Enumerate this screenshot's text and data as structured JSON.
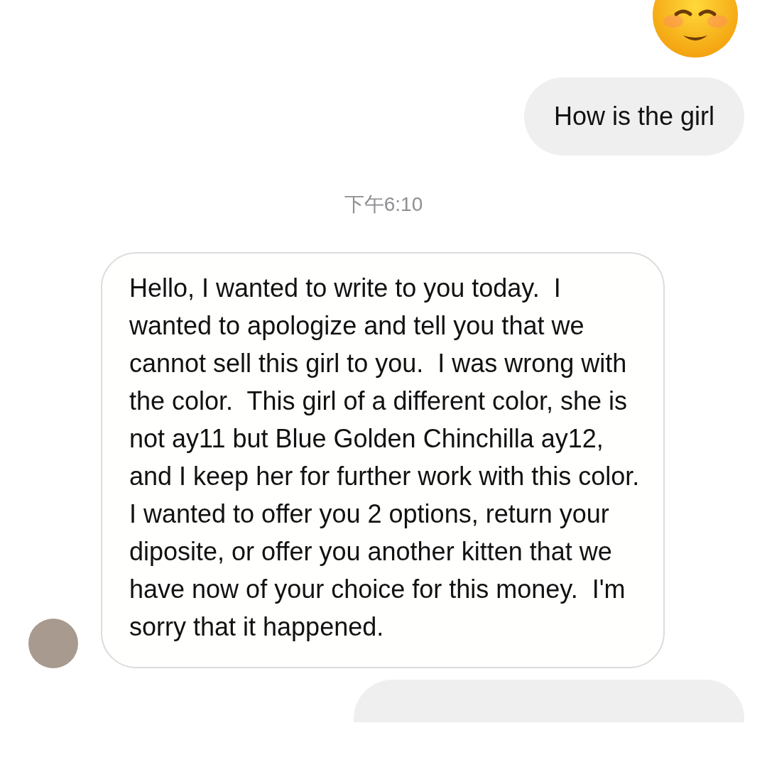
{
  "messages": [
    {
      "kind": "emoji"
    },
    {
      "kind": "outgoing",
      "text": "How is the girl"
    },
    {
      "kind": "time",
      "text": "下午6:10"
    },
    {
      "kind": "incoming",
      "text": "Hello, I wanted to write to you today.  I wanted to apologize and tell you that we cannot sell this girl to you.  I was wrong with the color.  This girl of a different color, she is not ay11 but Blue Golden Chinchilla ay12, and I keep her for further work with this color.  I wanted to offer you 2 options, return your diposite, or offer you another kitten that we have now of your choice for this money.  I'm sorry that it happened."
    },
    {
      "kind": "outgoing"
    }
  ]
}
